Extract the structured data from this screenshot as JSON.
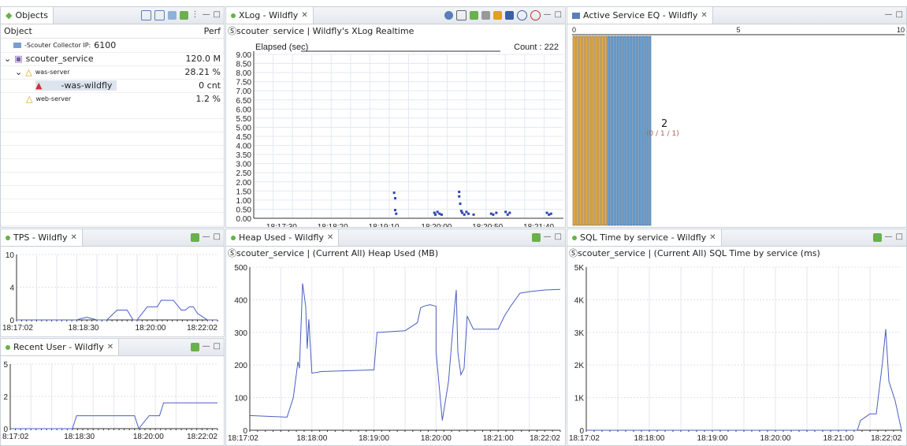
{
  "colors": {
    "line": "#4a5fc1",
    "eq_orange": "#e8b04a",
    "eq_blue": "#6ea6d8",
    "scatter": "#2d46b5"
  },
  "objects": {
    "tab_label": "Objects",
    "col_object": "Object",
    "col_perf": "Perf",
    "rows": [
      {
        "name": "-Scouter Collector IP:",
        "name2": "6100",
        "value": "",
        "icon": "server-icon"
      },
      {
        "name": "scouter_service",
        "value": "120.0 M",
        "icon": "service-icon"
      },
      {
        "name": "was-server",
        "value": "28.21 %",
        "icon": "linux-icon"
      },
      {
        "name": "-was-wildfly",
        "value": "0 cnt",
        "icon": "wildfly-icon"
      },
      {
        "name": "web-server",
        "value": "1.2 %",
        "icon": "linux-icon"
      }
    ]
  },
  "xlog": {
    "tab_label": "XLog - Wildfly",
    "subtitle": "Ⓢscouter_service | Wildfly's XLog Realtime",
    "elapsed_label": "Elapsed (sec)",
    "count_label": "Count : 222"
  },
  "active_eq": {
    "tab_label": "Active Service EQ - Wildfly",
    "center_value": "2",
    "center_detail": "(0 / 1 / 1)"
  },
  "tps": {
    "tab_label": "TPS - Wildfly"
  },
  "recent_user": {
    "tab_label": "Recent User - Wildfly"
  },
  "heap": {
    "tab_label": "Heap Used - Wildfly",
    "subtitle": "Ⓢscouter_service | (Current All) Heap Used (MB)"
  },
  "sql": {
    "tab_label": "SQL Time by service - Wildfly",
    "subtitle": "Ⓢscouter_service | (Current All) SQL Time by service (ms)"
  },
  "chart_data": [
    {
      "id": "xlog",
      "type": "scatter",
      "ylim": [
        0,
        9
      ],
      "yticks": [
        "9.00",
        "8.50",
        "8.00",
        "7.50",
        "7.00",
        "6.50",
        "6.00",
        "5.50",
        "5.00",
        "4.50",
        "4.00",
        "3.50",
        "3.00",
        "2.50",
        "2.00",
        "1.50",
        "1.00",
        "0.50",
        "0.00"
      ],
      "xtick_labels": [
        "18:17:30",
        "18:18:20",
        "18:19:10",
        "18:20:00",
        "18:20:50",
        "18:21:40"
      ],
      "xlim_seconds": [
        0,
        300
      ],
      "points": [
        [
          136,
          1.4
        ],
        [
          137,
          1.1
        ],
        [
          137,
          0.45
        ],
        [
          138,
          0.25
        ],
        [
          175,
          0.3
        ],
        [
          176,
          0.2
        ],
        [
          178,
          0.35
        ],
        [
          180,
          0.25
        ],
        [
          182,
          0.2
        ],
        [
          199,
          1.45
        ],
        [
          199,
          1.2
        ],
        [
          200,
          0.8
        ],
        [
          201,
          0.4
        ],
        [
          202,
          0.3
        ],
        [
          204,
          0.2
        ],
        [
          206,
          0.35
        ],
        [
          208,
          0.25
        ],
        [
          213,
          0.2
        ],
        [
          230,
          0.25
        ],
        [
          232,
          0.2
        ],
        [
          235,
          0.3
        ],
        [
          244,
          0.35
        ],
        [
          246,
          0.2
        ],
        [
          248,
          0.3
        ],
        [
          284,
          0.3
        ],
        [
          286,
          0.2
        ],
        [
          288,
          0.25
        ]
      ]
    },
    {
      "id": "active_eq",
      "type": "bar",
      "xlim": [
        0,
        10
      ],
      "xticks": [
        "0",
        "5",
        "10"
      ],
      "orange_bars": 11,
      "blue_bars": 14
    },
    {
      "id": "tps",
      "type": "line",
      "ylim": [
        0,
        10
      ],
      "yticks": [
        "10",
        "4",
        "0"
      ],
      "xtick_labels": [
        "18:17:02",
        "18:18:30",
        "18:20:00",
        "18:22:02"
      ],
      "x": [
        0,
        0.2,
        0.3,
        0.32,
        0.35,
        0.4,
        0.42,
        0.45,
        0.5,
        0.55,
        0.58,
        0.6,
        0.65,
        0.7,
        0.72,
        0.75,
        0.78,
        0.82,
        0.84,
        0.86,
        0.88,
        0.9,
        0.95,
        1
      ],
      "y": [
        0,
        0,
        0,
        0.2,
        0.4,
        0,
        0,
        0,
        1.5,
        1.5,
        0,
        0,
        2,
        2,
        3,
        3,
        3,
        1.5,
        1.5,
        2,
        2,
        1,
        0,
        0
      ]
    },
    {
      "id": "recent_user",
      "type": "line",
      "ylim": [
        0,
        5
      ],
      "yticks": [
        "5",
        "2",
        "0"
      ],
      "xtick_labels": [
        "8:17:02",
        "18:18:30",
        "18:20:00",
        "18:22:02"
      ],
      "x": [
        0,
        0.3,
        0.32,
        0.6,
        0.62,
        0.67,
        0.69,
        0.72,
        0.74,
        1
      ],
      "y": [
        0,
        0,
        1,
        1,
        0,
        1,
        1,
        1,
        2,
        2
      ]
    },
    {
      "id": "heap",
      "type": "line",
      "ylim": [
        0,
        500
      ],
      "yticks": [
        "500",
        "400",
        "300",
        "200",
        "100",
        "0"
      ],
      "xtick_labels": [
        "18:17:02",
        "18:18:00",
        "18:19:00",
        "18:20:00",
        "18:21:00",
        "18:22:02"
      ],
      "x": [
        0,
        0.12,
        0.14,
        0.155,
        0.16,
        0.17,
        0.18,
        0.185,
        0.19,
        0.2,
        0.22,
        0.23,
        0.4,
        0.41,
        0.42,
        0.5,
        0.54,
        0.55,
        0.56,
        0.58,
        0.6,
        0.6,
        0.62,
        0.64,
        0.66,
        0.665,
        0.67,
        0.68,
        0.69,
        0.7,
        0.72,
        0.76,
        0.8,
        0.82,
        0.84,
        0.87,
        0.9,
        0.95,
        1
      ],
      "y": [
        45,
        40,
        100,
        210,
        190,
        450,
        380,
        250,
        340,
        175,
        178,
        180,
        185,
        300,
        300,
        305,
        330,
        375,
        380,
        385,
        380,
        240,
        30,
        150,
        380,
        430,
        240,
        170,
        190,
        350,
        310,
        310,
        310,
        350,
        380,
        420,
        425,
        430,
        432
      ]
    },
    {
      "id": "sql",
      "type": "line",
      "ylim": [
        0,
        5000
      ],
      "yticks": [
        "5K",
        "4K",
        "3K",
        "2K",
        "1K",
        "0"
      ],
      "xtick_labels": [
        "18:17:02",
        "18:18:00",
        "18:19:00",
        "18:20:00",
        "18:21:00",
        "18:22:02"
      ],
      "x": [
        0,
        0.85,
        0.86,
        0.87,
        0.9,
        0.92,
        0.93,
        0.94,
        0.95,
        0.96,
        0.97,
        0.98,
        1
      ],
      "y": [
        0,
        0,
        0,
        300,
        500,
        500,
        1300,
        2100,
        3100,
        1500,
        1200,
        900,
        0
      ]
    }
  ]
}
